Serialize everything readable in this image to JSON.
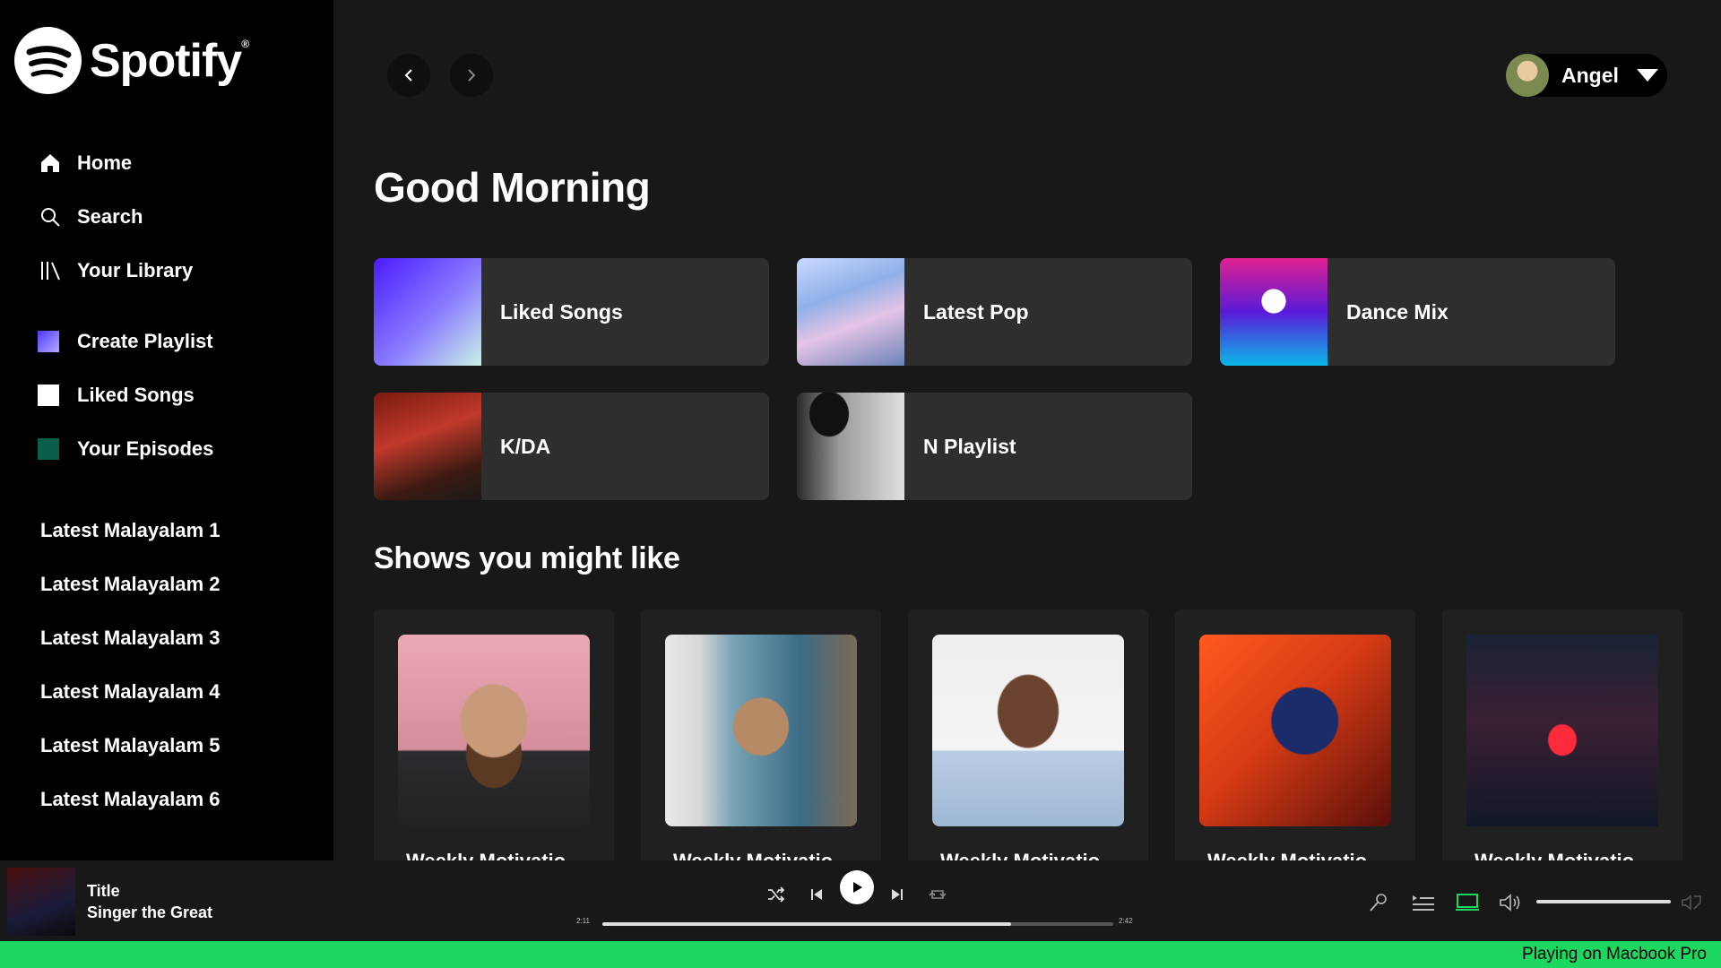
{
  "app": {
    "logo_text": "Spotify",
    "logo_mark": "®"
  },
  "sidebar": {
    "nav": [
      {
        "label": "Home",
        "icon": "home-icon"
      },
      {
        "label": "Search",
        "icon": "search-icon"
      },
      {
        "label": "Your Library",
        "icon": "library-icon"
      }
    ],
    "actions": [
      {
        "label": "Create Playlist",
        "color": "#6a5cff"
      },
      {
        "label": "Liked Songs",
        "color": "#ffffff"
      },
      {
        "label": "Your Episodes",
        "color": "#0b5f4a"
      }
    ],
    "playlists": [
      "Latest Malayalam 1",
      "Latest Malayalam 2",
      "Latest Malayalam 3",
      "Latest Malayalam 4",
      "Latest Malayalam 5",
      "Latest Malayalam 6"
    ]
  },
  "header": {
    "user_name": "Angel"
  },
  "main": {
    "greeting": "Good Morning",
    "quick_picks": [
      {
        "label": "Liked Songs"
      },
      {
        "label": "Latest Pop"
      },
      {
        "label": "Dance Mix"
      },
      {
        "label": "K/DA"
      },
      {
        "label": "N Playlist"
      }
    ],
    "shows_title": "Shows you might like",
    "shows": [
      {
        "title": "Weekly Motivatio"
      },
      {
        "title": "Weekly Motivatio"
      },
      {
        "title": "Weekly Motivatio"
      },
      {
        "title": "Weekly Motivatio"
      },
      {
        "title": "Weekly Motivatio"
      }
    ]
  },
  "player": {
    "title": "Title",
    "artist": "Singer the Great",
    "time_elapsed": "2:11",
    "time_total": "2:42",
    "progress_fraction": 0.8,
    "volume_fraction": 1.0,
    "accent": "#1ed760"
  },
  "statusbar": {
    "text": "Playing on Macbook Pro"
  }
}
